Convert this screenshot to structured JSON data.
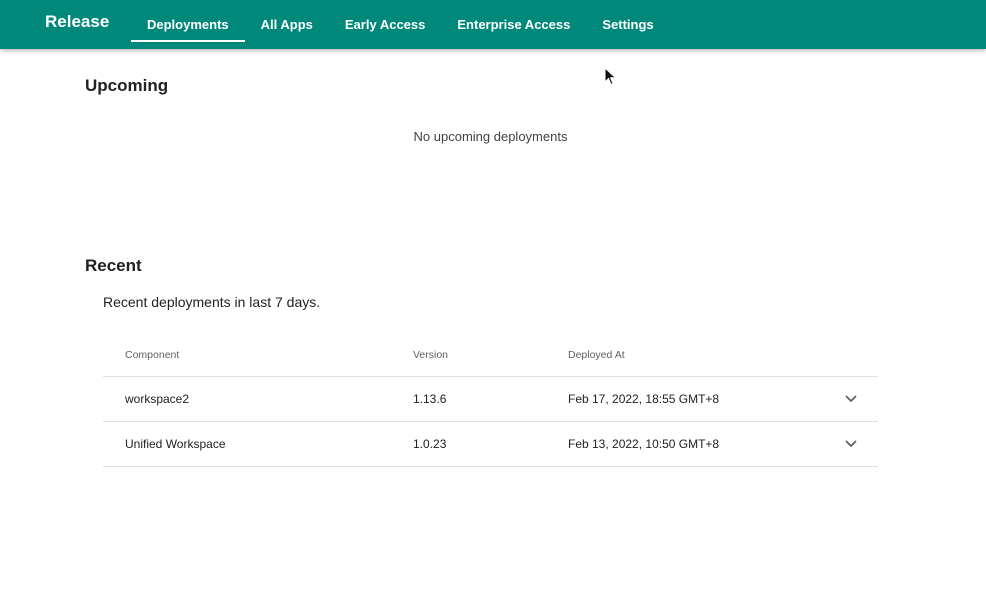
{
  "app": {
    "title": "Release",
    "brand_color": "#00897b"
  },
  "nav": {
    "tabs": [
      {
        "label": "Deployments",
        "active": true
      },
      {
        "label": "All Apps",
        "active": false
      },
      {
        "label": "Early Access",
        "active": false
      },
      {
        "label": "Enterprise Access",
        "active": false
      },
      {
        "label": "Settings",
        "active": false
      }
    ]
  },
  "upcoming": {
    "title": "Upcoming",
    "empty_message": "No upcoming deployments"
  },
  "recent": {
    "title": "Recent",
    "description": "Recent deployments in last 7 days.",
    "columns": {
      "component": "Component",
      "version": "Version",
      "deployed_at": "Deployed At"
    },
    "rows": [
      {
        "component": "workspace2",
        "version": "1.13.6",
        "deployed_at": "Feb 17, 2022, 18:55 GMT+8",
        "expand_icon": "chevron-down-icon"
      },
      {
        "component": "Unified Workspace",
        "version": "1.0.23",
        "deployed_at": "Feb 13, 2022, 10:50 GMT+8",
        "expand_icon": "chevron-down-icon"
      }
    ]
  }
}
